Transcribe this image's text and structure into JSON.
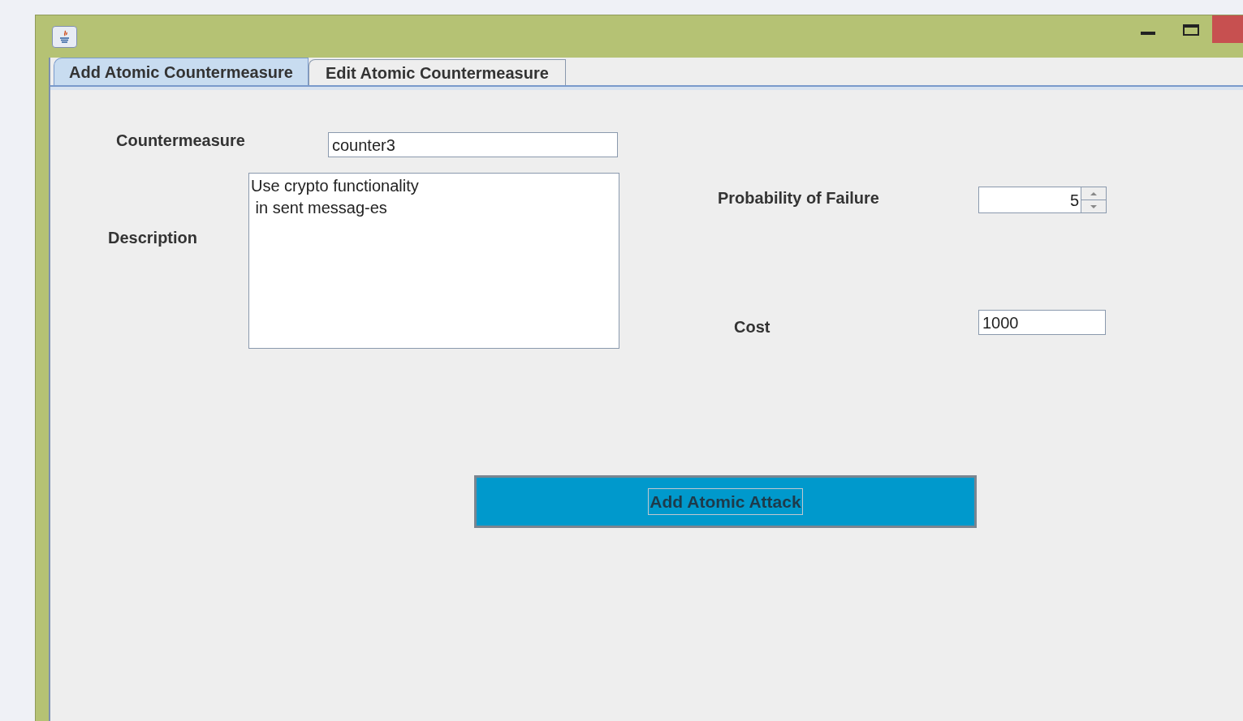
{
  "tabs": [
    {
      "label": "Add Atomic Countermeasure",
      "selected": true
    },
    {
      "label": "Edit Atomic Countermeasure",
      "selected": false
    }
  ],
  "form": {
    "countermeasure": {
      "label": "Countermeasure",
      "value": "counter3"
    },
    "description": {
      "label": "Description",
      "lines": [
        "Use crypto functionality",
        " in sent messag-es"
      ]
    },
    "probability_of_failure": {
      "label": "Probability of Failure",
      "value": "5"
    },
    "cost": {
      "label": "Cost",
      "value": "1000"
    }
  },
  "button": {
    "label": "Add Atomic Attack"
  }
}
